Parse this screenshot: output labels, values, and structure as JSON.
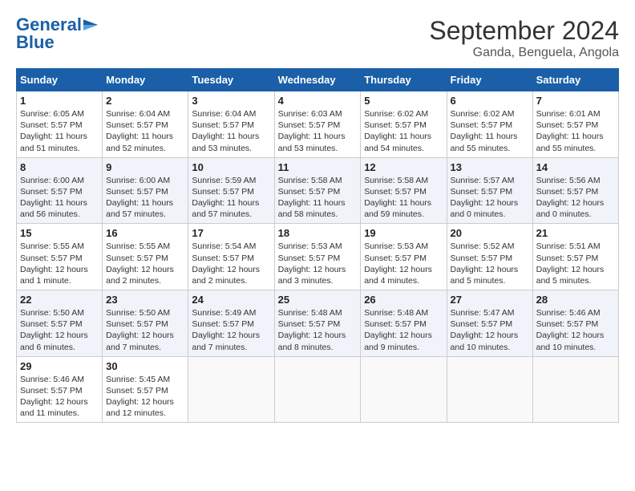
{
  "logo": {
    "line1": "General",
    "line2": "Blue",
    "icon": "▶"
  },
  "title": "September 2024",
  "subtitle": "Ganda, Benguela, Angola",
  "days_of_week": [
    "Sunday",
    "Monday",
    "Tuesday",
    "Wednesday",
    "Thursday",
    "Friday",
    "Saturday"
  ],
  "weeks": [
    [
      {
        "day": "1",
        "info": "Sunrise: 6:05 AM\nSunset: 5:57 PM\nDaylight: 11 hours\nand 51 minutes."
      },
      {
        "day": "2",
        "info": "Sunrise: 6:04 AM\nSunset: 5:57 PM\nDaylight: 11 hours\nand 52 minutes."
      },
      {
        "day": "3",
        "info": "Sunrise: 6:04 AM\nSunset: 5:57 PM\nDaylight: 11 hours\nand 53 minutes."
      },
      {
        "day": "4",
        "info": "Sunrise: 6:03 AM\nSunset: 5:57 PM\nDaylight: 11 hours\nand 53 minutes."
      },
      {
        "day": "5",
        "info": "Sunrise: 6:02 AM\nSunset: 5:57 PM\nDaylight: 11 hours\nand 54 minutes."
      },
      {
        "day": "6",
        "info": "Sunrise: 6:02 AM\nSunset: 5:57 PM\nDaylight: 11 hours\nand 55 minutes."
      },
      {
        "day": "7",
        "info": "Sunrise: 6:01 AM\nSunset: 5:57 PM\nDaylight: 11 hours\nand 55 minutes."
      }
    ],
    [
      {
        "day": "8",
        "info": "Sunrise: 6:00 AM\nSunset: 5:57 PM\nDaylight: 11 hours\nand 56 minutes."
      },
      {
        "day": "9",
        "info": "Sunrise: 6:00 AM\nSunset: 5:57 PM\nDaylight: 11 hours\nand 57 minutes."
      },
      {
        "day": "10",
        "info": "Sunrise: 5:59 AM\nSunset: 5:57 PM\nDaylight: 11 hours\nand 57 minutes."
      },
      {
        "day": "11",
        "info": "Sunrise: 5:58 AM\nSunset: 5:57 PM\nDaylight: 11 hours\nand 58 minutes."
      },
      {
        "day": "12",
        "info": "Sunrise: 5:58 AM\nSunset: 5:57 PM\nDaylight: 11 hours\nand 59 minutes."
      },
      {
        "day": "13",
        "info": "Sunrise: 5:57 AM\nSunset: 5:57 PM\nDaylight: 12 hours\nand 0 minutes."
      },
      {
        "day": "14",
        "info": "Sunrise: 5:56 AM\nSunset: 5:57 PM\nDaylight: 12 hours\nand 0 minutes."
      }
    ],
    [
      {
        "day": "15",
        "info": "Sunrise: 5:55 AM\nSunset: 5:57 PM\nDaylight: 12 hours\nand 1 minute."
      },
      {
        "day": "16",
        "info": "Sunrise: 5:55 AM\nSunset: 5:57 PM\nDaylight: 12 hours\nand 2 minutes."
      },
      {
        "day": "17",
        "info": "Sunrise: 5:54 AM\nSunset: 5:57 PM\nDaylight: 12 hours\nand 2 minutes."
      },
      {
        "day": "18",
        "info": "Sunrise: 5:53 AM\nSunset: 5:57 PM\nDaylight: 12 hours\nand 3 minutes."
      },
      {
        "day": "19",
        "info": "Sunrise: 5:53 AM\nSunset: 5:57 PM\nDaylight: 12 hours\nand 4 minutes."
      },
      {
        "day": "20",
        "info": "Sunrise: 5:52 AM\nSunset: 5:57 PM\nDaylight: 12 hours\nand 5 minutes."
      },
      {
        "day": "21",
        "info": "Sunrise: 5:51 AM\nSunset: 5:57 PM\nDaylight: 12 hours\nand 5 minutes."
      }
    ],
    [
      {
        "day": "22",
        "info": "Sunrise: 5:50 AM\nSunset: 5:57 PM\nDaylight: 12 hours\nand 6 minutes."
      },
      {
        "day": "23",
        "info": "Sunrise: 5:50 AM\nSunset: 5:57 PM\nDaylight: 12 hours\nand 7 minutes."
      },
      {
        "day": "24",
        "info": "Sunrise: 5:49 AM\nSunset: 5:57 PM\nDaylight: 12 hours\nand 7 minutes."
      },
      {
        "day": "25",
        "info": "Sunrise: 5:48 AM\nSunset: 5:57 PM\nDaylight: 12 hours\nand 8 minutes."
      },
      {
        "day": "26",
        "info": "Sunrise: 5:48 AM\nSunset: 5:57 PM\nDaylight: 12 hours\nand 9 minutes."
      },
      {
        "day": "27",
        "info": "Sunrise: 5:47 AM\nSunset: 5:57 PM\nDaylight: 12 hours\nand 10 minutes."
      },
      {
        "day": "28",
        "info": "Sunrise: 5:46 AM\nSunset: 5:57 PM\nDaylight: 12 hours\nand 10 minutes."
      }
    ],
    [
      {
        "day": "29",
        "info": "Sunrise: 5:46 AM\nSunset: 5:57 PM\nDaylight: 12 hours\nand 11 minutes."
      },
      {
        "day": "30",
        "info": "Sunrise: 5:45 AM\nSunset: 5:57 PM\nDaylight: 12 hours\nand 12 minutes."
      },
      {
        "day": "",
        "info": ""
      },
      {
        "day": "",
        "info": ""
      },
      {
        "day": "",
        "info": ""
      },
      {
        "day": "",
        "info": ""
      },
      {
        "day": "",
        "info": ""
      }
    ]
  ]
}
